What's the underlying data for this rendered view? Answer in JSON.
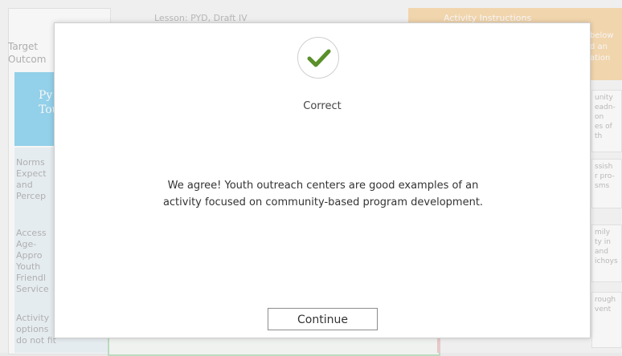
{
  "background": {
    "header_title": "Lesson: PYD, Draft IV",
    "right_header": "Activity Instructions",
    "right_header_text": [
      "below",
      "d an",
      "ation"
    ],
    "left_panel": {
      "target_label": [
        "Target",
        "Outcom"
      ],
      "blue_box": [
        "Py",
        "Tou"
      ],
      "outcomes": [
        [
          "Norms",
          "Expect",
          "and",
          "Percep"
        ],
        [
          "Access",
          "Age-",
          "Appro",
          "Youth",
          "Friendl",
          "Service"
        ],
        [
          "Activity",
          "options",
          "do not fit"
        ]
      ]
    },
    "right_cards": [
      [
        "unity",
        "eadn-",
        "on",
        "es of",
        "th"
      ],
      [
        "ssish",
        "r pro-",
        "sms"
      ],
      [
        "mily",
        "ty in",
        "and",
        "ichoys"
      ],
      [
        "rough",
        "vent"
      ]
    ]
  },
  "modal": {
    "status_icon": "check-icon",
    "accent_color": "#5a8f2a",
    "result_title": "Correct",
    "feedback_text": "We agree! Youth outreach centers are good examples of an activity focused on community-based program development.",
    "continue_label": "Continue"
  }
}
